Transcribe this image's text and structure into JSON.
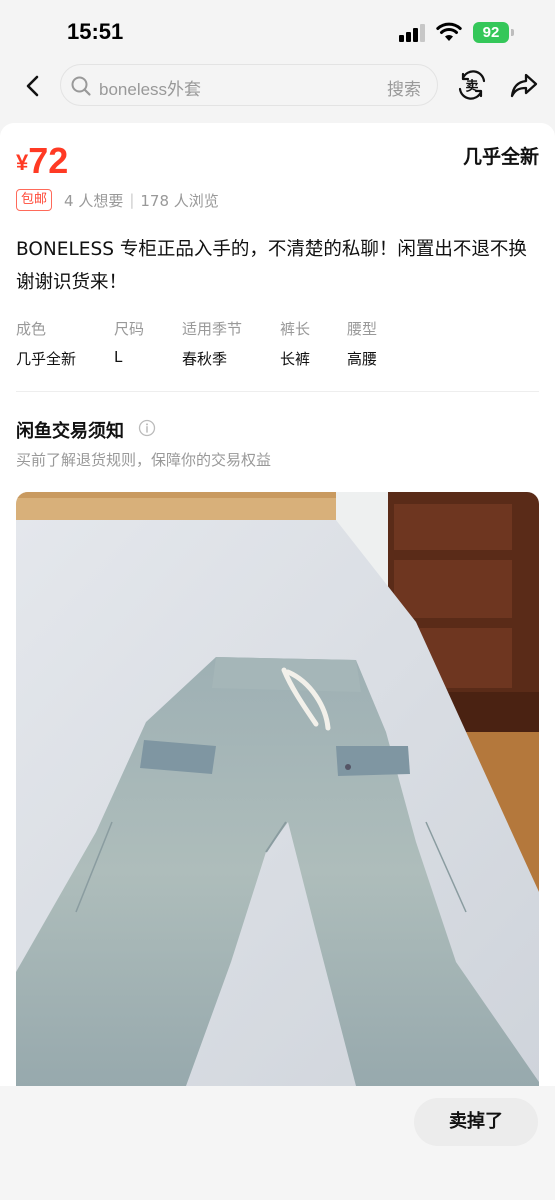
{
  "status_bar": {
    "time": "15:51",
    "battery": "92"
  },
  "nav": {
    "search_query": "boneless外套",
    "search_button": "搜索"
  },
  "item": {
    "price_symbol": "¥",
    "price": "72",
    "condition": "几乎全新",
    "shipping_tag": "包邮",
    "wants": "4 人想要",
    "views": "178 人浏览",
    "description": "BONELESS 专柜正品入手的，不清楚的私聊！闲置出不退不换谢谢识货来！",
    "attributes": [
      {
        "key": "成色",
        "value": "几乎全新"
      },
      {
        "key": "尺码",
        "value": "L"
      },
      {
        "key": "适用季节",
        "value": "春秋季"
      },
      {
        "key": "裤长",
        "value": "长裤"
      },
      {
        "key": "腰型",
        "value": "高腰"
      }
    ]
  },
  "notice": {
    "title": "闲鱼交易须知",
    "subtitle": "买前了解退货规则，保障你的交易权益"
  },
  "bottom": {
    "sold_button": "卖掉了"
  },
  "colors": {
    "price": "#ff3a24",
    "accent_yellow": "#ffe94a",
    "battery": "#34c759"
  }
}
